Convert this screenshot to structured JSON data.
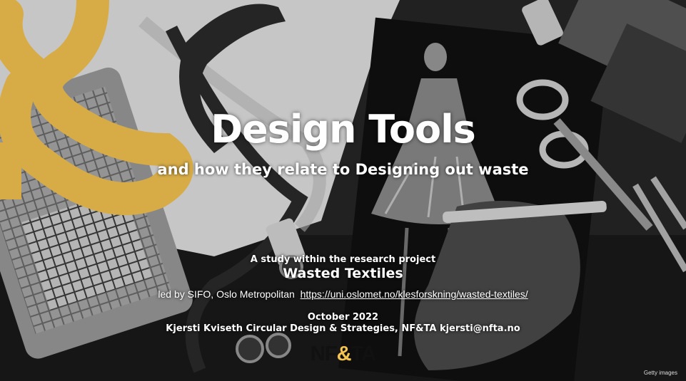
{
  "slide": {
    "title": "Design Tools",
    "subtitle": "and how they relate to Designing out waste",
    "study_label": "A study within the research project",
    "project_name": "Wasted Textiles",
    "led_by": "led by SIFO, Oslo Metropolitan",
    "project_url": "https://uni.oslomet.no/klesforskning/wasted-textiles/",
    "date": "October 2022",
    "author_line": "Kjersti Kviseth   Circular Design & Strategies, NF&TA  kjersti@nfta.no",
    "logo_left": "NF",
    "logo_amp": "&",
    "logo_right": "TA",
    "image_credit": "Getty images"
  },
  "colors": {
    "accent": "#f5c451",
    "text": "#ffffff",
    "background": "#1c1c1c"
  }
}
